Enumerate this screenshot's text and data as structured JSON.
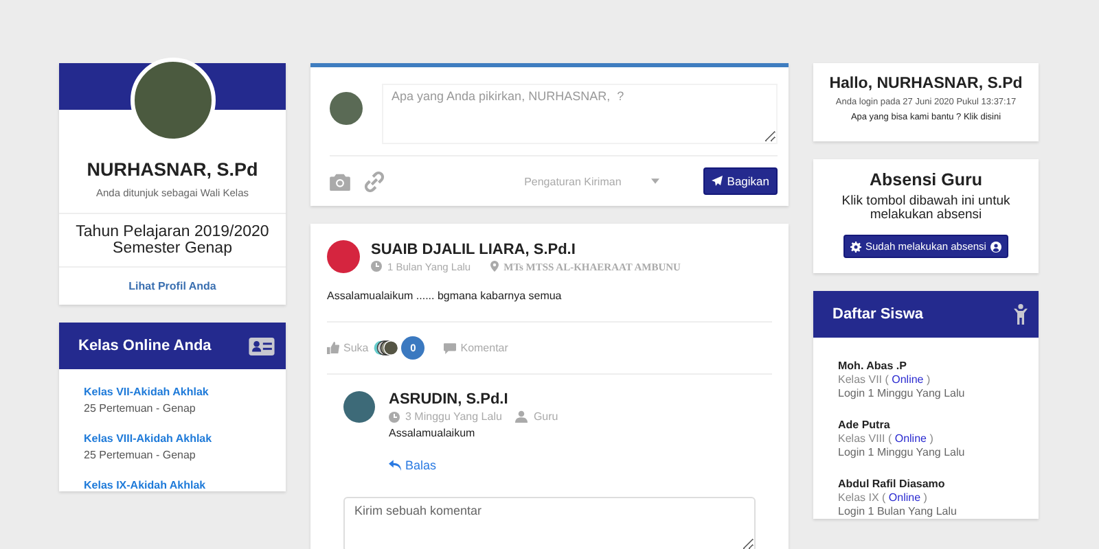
{
  "profile": {
    "name": "NURHASNAR, S.Pd",
    "note": "Anda ditunjuk sebagai Wali Kelas",
    "year": "Tahun Pelajaran 2019/2020",
    "semester": "Semester Genap",
    "link": "Lihat Profil Anda"
  },
  "classes": {
    "title": "Kelas Online Anda",
    "items": [
      {
        "name": "Kelas VII-Akidah Akhlak",
        "meta": "25 Pertemuan - Genap"
      },
      {
        "name": "Kelas VIII-Akidah Akhlak",
        "meta": "25 Pertemuan - Genap"
      },
      {
        "name": "Kelas IX-Akidah Akhlak"
      }
    ]
  },
  "composer": {
    "placeholder": "Apa yang Anda pikirkan, NURHASNAR,  ?",
    "privacy": "Pengaturan Kiriman",
    "submit": "Bagikan"
  },
  "post": {
    "author": "SUAIB DJALIL LIARA, S.Pd.I",
    "time": "1 Bulan Yang Lalu",
    "school": "MTs MTSS AL-KHAERAAT AMBUNU",
    "text": "Assalamualaikum ...... bgmana kabarnya semua",
    "like": "Suka",
    "like_count": "0",
    "comment": "Komentar",
    "comments": [
      {
        "author": "ASRUDIN, S.Pd.I",
        "time": "3 Minggu Yang Lalu",
        "role": "Guru",
        "text": "Assalamualaikum",
        "reply": "Balas"
      }
    ],
    "comment_placeholder": "Kirim sebuah komentar"
  },
  "greeting": {
    "title": "Hallo, NURHASNAR, S.Pd",
    "login": "Anda login pada 27 Juni 2020 Pukul 13:37:17",
    "help": "Apa yang bisa kami bantu ? Klik disini"
  },
  "attendance": {
    "title": "Absensi Guru",
    "text": "Klik tombol dibawah ini untuk melakukan absensi",
    "button": "Sudah melakukan absensi"
  },
  "students": {
    "title": "Daftar Siswa",
    "items": [
      {
        "name": "Moh. Abas .P",
        "class": "Kelas VII (",
        "status": "Online",
        "class_end": ")",
        "login": "Login 1 Minggu Yang Lalu"
      },
      {
        "name": "Ade Putra",
        "class": "Kelas VIII (",
        "status": "Online",
        "class_end": ")",
        "login": "Login 1 Minggu Yang Lalu"
      },
      {
        "name": "Abdul Rafil Diasamo",
        "class": "Kelas IX (",
        "status": "Online",
        "class_end": ")",
        "login": "Login 1 Bulan Yang Lalu"
      }
    ]
  }
}
